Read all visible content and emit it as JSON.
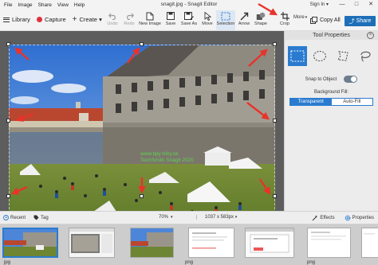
{
  "window": {
    "menu": [
      "File",
      "Image",
      "Share",
      "View",
      "Help"
    ],
    "title": "snagit.jpg - Snagit Editor",
    "sign_in": "Sign In ▾",
    "controls": [
      "—",
      "□",
      "✕"
    ]
  },
  "toolbar": {
    "library_label": "Library",
    "capture_label": "Capture",
    "create_label": "Create ▾",
    "tools": [
      {
        "label": "Undo",
        "icon": "undo-icon",
        "disabled": true
      },
      {
        "label": "Redo",
        "icon": "redo-icon",
        "disabled": true
      },
      {
        "label": "New Image",
        "icon": "new-image-icon",
        "disabled": false
      },
      {
        "label": "Save",
        "icon": "save-icon",
        "disabled": false
      },
      {
        "label": "Save As",
        "icon": "save-as-icon",
        "disabled": false
      },
      {
        "label": "Move",
        "icon": "move-icon",
        "disabled": false
      },
      {
        "label": "Selection",
        "icon": "selection-icon",
        "disabled": false,
        "selected": true
      },
      {
        "label": "Arrow",
        "icon": "arrow-icon",
        "disabled": false
      },
      {
        "label": "Shape",
        "icon": "shape-icon",
        "disabled": false
      }
    ],
    "crop_label": "Crop",
    "more_label": "More",
    "copy_all_label": "Copy All",
    "share_label": "Share"
  },
  "canvas": {
    "watermark_line1": "www.tipy-triky.sk",
    "watermark_line2": "TechSmith Snagit 2020",
    "accent_arrow_color": "#e8332a"
  },
  "panel": {
    "title": "Tool Properties",
    "shapes": [
      "rectangle-select",
      "ellipse-select",
      "freehand-select",
      "lasso-select"
    ],
    "snap_label": "Snap to Object",
    "snap_on": true,
    "bg_fill_label": "Background Fill:",
    "fill_options": [
      "Transparent",
      "Auto-Fill"
    ],
    "fill_selected": "Transparent"
  },
  "statusbar": {
    "recent_label": "Recent",
    "tag_label": "Tag",
    "zoom": "70%",
    "dimensions": "1037 x 583px",
    "effects_label": "Effects",
    "properties_label": "Properties"
  },
  "tray": {
    "thumbnail_labels": [
      "jpg",
      "png",
      "png"
    ]
  },
  "colors": {
    "accent": "#2a7bd0",
    "share": "#1e6fb8",
    "capture": "#e0303c"
  }
}
